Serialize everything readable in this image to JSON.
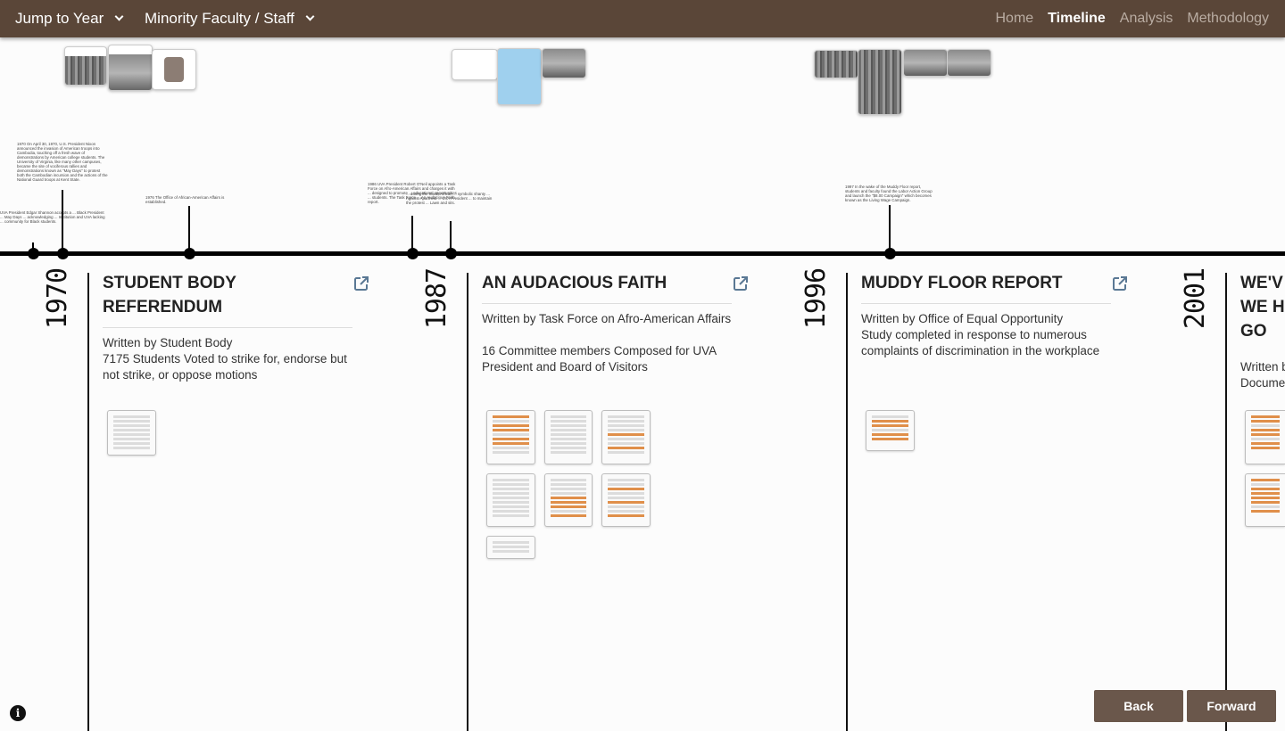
{
  "topbar": {
    "jump_label": "Jump to Year",
    "category_label": "Minority Faculty / Staff",
    "nav": [
      {
        "label": "Home",
        "active": false
      },
      {
        "label": "Timeline",
        "active": true
      },
      {
        "label": "Analysis",
        "active": false
      },
      {
        "label": "Methodology",
        "active": false
      }
    ]
  },
  "cards": [
    {
      "year": "1970",
      "title": "STUDENT BODY REFERENDUM",
      "written_by": "Written by Student Body",
      "description": "7175 Students Voted to strike for, endorse but not strike, or oppose motions"
    },
    {
      "year": "1987",
      "title": "AN AUDACIOUS FAITH",
      "written_by": "Written by Task Force on Afro-American Affairs",
      "description": "16 Committee members Composed for UVA President and Board of Visitors"
    },
    {
      "year": "1996",
      "title": "MUDDY FLOOR REPORT",
      "written_by": "Written by Office of Equal Opportunity",
      "description": "Study completed in response to numerous complaints of discrimination in the workplace"
    },
    {
      "year": "2001",
      "title": "WE'V WE H GO",
      "written_by": "Written b",
      "description": "Docume"
    }
  ],
  "notes": {
    "n1970": "1970 On April 30, 1970, U.S. President Nixon announced the invasion of American troops into Cambodia, touching off a fresh wave of demonstrations by American college students. The University of Virginia, like many other campuses, became the site of vociferous rallies and demonstrations known as \"May Days\" to protest both the Cambodian incursion and the actions of the National Guard troops at Kent State.",
    "n1970b": "UVA President Edgar Shannon accepts a ... Black President ... May Days ... acknowledging ... Institution and UVA lacking ... community for Black students.",
    "n1976": "1976 The Office of African-American Affairs is established.",
    "n1986": "1986 UVA President Robert O'Neil appoints a Task Force on Afro-American Affairs and charges it with ... designed to promote ... educational opportunities ... students. The Task Force ... An Audacious Faith report.",
    "n1987": "... during the South African ... symbolic shanty ... Against Apartheid ... UVA President ... to maintain the protest ... Lawn and sits.",
    "n1997": "1997 In the wake of the Muddy Floor report, students and faculty found the Labor Action Group and launch the \"$8.00 Campaign\" which becomes known as the Living Wage Campaign."
  },
  "icons": {
    "external": "external-link-icon",
    "info": "info-icon",
    "chevron": "chevron-down-icon"
  },
  "buttons": {
    "back": "Back",
    "forward": "Forward"
  },
  "colors": {
    "topbar": "#5a4638",
    "button": "#6a574b",
    "accent_doc": "#e08f4a",
    "link_icon": "#5a7894"
  }
}
